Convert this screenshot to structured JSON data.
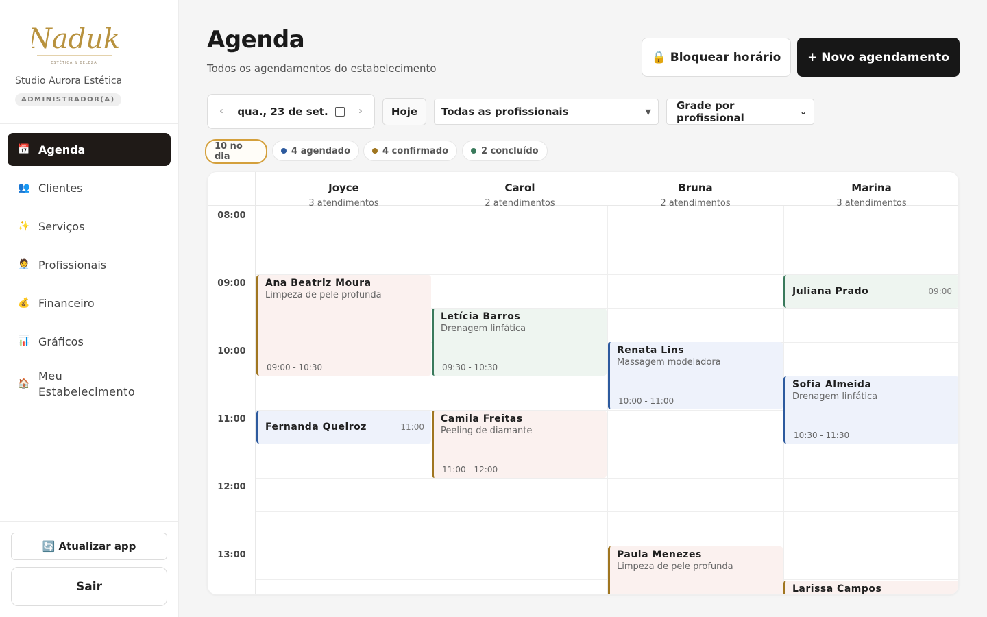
{
  "brand": {
    "logo_text": "Naduk",
    "logo_tagline": "ESTÉTICA & BELEZA",
    "studio_name": "Studio Aurora Estética",
    "role": "ADMINISTRADOR(A)"
  },
  "nav": {
    "items": [
      {
        "icon": "📅",
        "label": "Agenda",
        "active": true
      },
      {
        "icon": "👥",
        "label": "Clientes"
      },
      {
        "icon": "✨",
        "label": "Serviços"
      },
      {
        "icon": "🧑‍💼",
        "label": "Profissionais"
      },
      {
        "icon": "💰",
        "label": "Financeiro"
      },
      {
        "icon": "📊",
        "label": "Gráficos"
      },
      {
        "icon": "🏠",
        "label": "Meu Estabelecimento"
      }
    ]
  },
  "sidebar_footer": {
    "update_label": "🔄 Atualizar app",
    "logout_label": "Sair"
  },
  "header": {
    "title": "Agenda",
    "subtitle": "Todos os agendamentos do estabelecimento",
    "block_label": "🔒 Bloquear horário",
    "new_label": "+ Novo agendamento"
  },
  "toolbar": {
    "prev": "‹",
    "next": "›",
    "date": "qua., 23 de set.",
    "today_label": "Hoje",
    "professional_filter": "Todas as profissionais",
    "view_mode": "Grade por profissional"
  },
  "chips": {
    "day_total": "10 no dia",
    "scheduled": "4 agendado",
    "confirmed": "4 confirmado",
    "completed": "2 concluído",
    "colors": {
      "scheduled": "#2d5a9e",
      "confirmed": "#a07620",
      "completed": "#3a7a5c",
      "active_border": "#d4a03c"
    }
  },
  "calendar": {
    "hours": [
      "08:00",
      "09:00",
      "10:00",
      "11:00",
      "12:00",
      "13:00"
    ],
    "professionals": [
      {
        "name": "Joyce",
        "count": "3 atendimentos"
      },
      {
        "name": "Carol",
        "count": "2 atendimentos"
      },
      {
        "name": "Bruna",
        "count": "2 atendimentos"
      },
      {
        "name": "Marina",
        "count": "3 atendimentos"
      }
    ],
    "appointments": [
      {
        "column": "Joyce",
        "client": "Ana Beatriz Moura",
        "service": "Limpeza de pele profunda",
        "range": "09:00 - 10:30",
        "status": "confirmed"
      },
      {
        "column": "Joyce",
        "client": "Fernanda Queiroz",
        "start": "11:00",
        "status": "scheduled"
      },
      {
        "column": "Carol",
        "client": "Letícia Barros",
        "service": "Drenagem linfática",
        "range": "09:30 - 10:30",
        "status": "completed"
      },
      {
        "column": "Carol",
        "client": "Camila Freitas",
        "service": "Peeling de diamante",
        "range": "11:00 - 12:00",
        "status": "confirmed"
      },
      {
        "column": "Bruna",
        "client": "Renata Lins",
        "service": "Massagem modeladora",
        "range": "10:00 - 11:00",
        "status": "scheduled"
      },
      {
        "column": "Bruna",
        "client": "Paula Menezes",
        "service": "Limpeza de pele profunda",
        "status": "confirmed"
      },
      {
        "column": "Marina",
        "client": "Juliana Prado",
        "start": "09:00",
        "status": "completed"
      },
      {
        "column": "Marina",
        "client": "Sofia Almeida",
        "service": "Drenagem linfática",
        "range": "10:30 - 11:30",
        "status": "scheduled"
      },
      {
        "column": "Marina",
        "client": "Larissa Campos",
        "status": "confirmed"
      }
    ]
  }
}
